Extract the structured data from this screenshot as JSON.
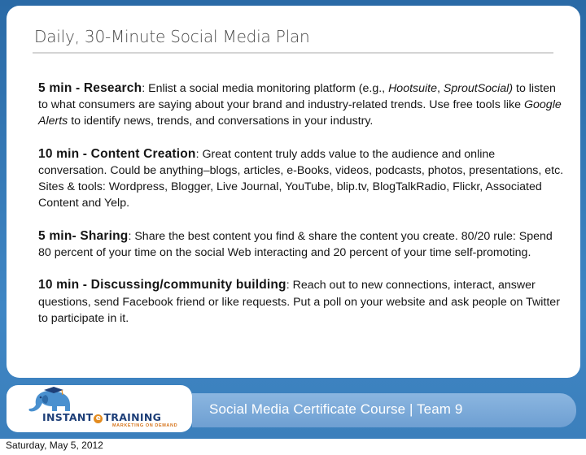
{
  "slide": {
    "title": "Daily, 30-Minute Social Media Plan",
    "sections": [
      {
        "lead": "5 min - Research",
        "pre": ": Enlist a social media monitoring platform (e.g., ",
        "i1": "Hootsuite",
        "mid1": ", ",
        "i2": "SproutSocial)",
        "mid2": " to listen to what consumers are saying about your brand and industry-related trends. Use free tools like ",
        "i3": "Google Alerts",
        "post": " to identify news, trends, and conversations in your industry."
      },
      {
        "lead": "10 min - Content Creation",
        "text": ": Great content truly adds value to the audience and online conversation. Could be anything–blogs, articles, e-Books, videos, podcasts, photos, presentations, etc. Sites & tools:  Wordpress, Blogger, Live Journal, YouTube, blip.tv, BlogTalkRadio, Flickr, Associated Content and Yelp."
      },
      {
        "lead": "5 min- Sharing",
        "text": ":  Share the best content you find & share the content you create. 80/20 rule: Spend 80 percent of your time on the social Web interacting and 20 percent of your time self-promoting."
      },
      {
        "lead": "10 min - Discussing/community building",
        "text": ": Reach out to new connections, interact, answer questions, send Facebook friend or like requests. Put a poll on your website and ask people on Twitter to participate in it."
      }
    ]
  },
  "footer": {
    "logo_part1": "INSTANT",
    "logo_e": "e",
    "logo_part2": "TRAINING",
    "logo_tagline": "MARKETING ON DEMAND",
    "course": "Social Media Certificate Course  |  Team 9",
    "date": "Saturday, May 5, 2012"
  },
  "colors": {
    "frame": "#3b7fbc",
    "course_bar": "#7aa9d8",
    "logo_navy": "#1e3f78",
    "logo_orange": "#e38b1f"
  },
  "icons": [
    "elephant-logo-icon"
  ]
}
